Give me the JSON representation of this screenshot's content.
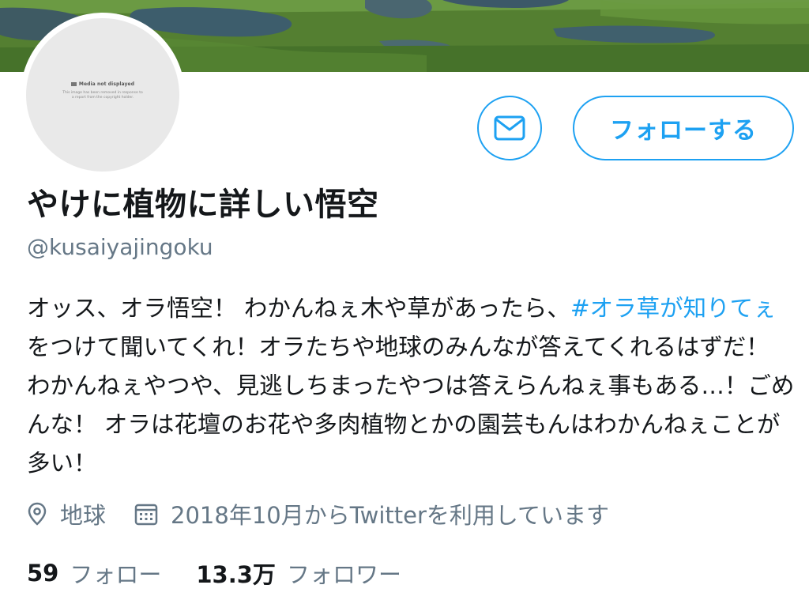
{
  "profile": {
    "display_name": "やけに植物に詳しい悟空",
    "handle": "@kusaiyajingoku",
    "avatar_placeholder": {
      "title": "Media not displayed",
      "description": "This image has been removed in response to a report from the copyright holder."
    }
  },
  "actions": {
    "message_icon": "mail-icon",
    "follow_label": "フォローする"
  },
  "bio": {
    "before": "オッス、オラ悟空！ わかんねぇ木や草があったら、",
    "hashtag": "#オラ草が知りてぇ",
    "after": " をつけて聞いてくれ！オラたちや地球のみんなが答えてくれるはずだ！ わかんねぇやつや、見逃しちまったやつは答えらんねぇ事もある…！ごめんな！ オラは花壇のお花や多肉植物とかの園芸もんはわかんねぇことが多い！"
  },
  "meta": {
    "location_icon": "location-pin-icon",
    "location": "地球",
    "joined_icon": "calendar-icon",
    "joined": "2018年10月からTwitterを利用しています"
  },
  "stats": {
    "following_count": "59",
    "following_label": "フォロー",
    "followers_count": "13.3万",
    "followers_label": "フォロワー"
  },
  "colors": {
    "accent": "#1da1f2",
    "secondary_text": "#657786",
    "primary_text": "#14171a"
  }
}
